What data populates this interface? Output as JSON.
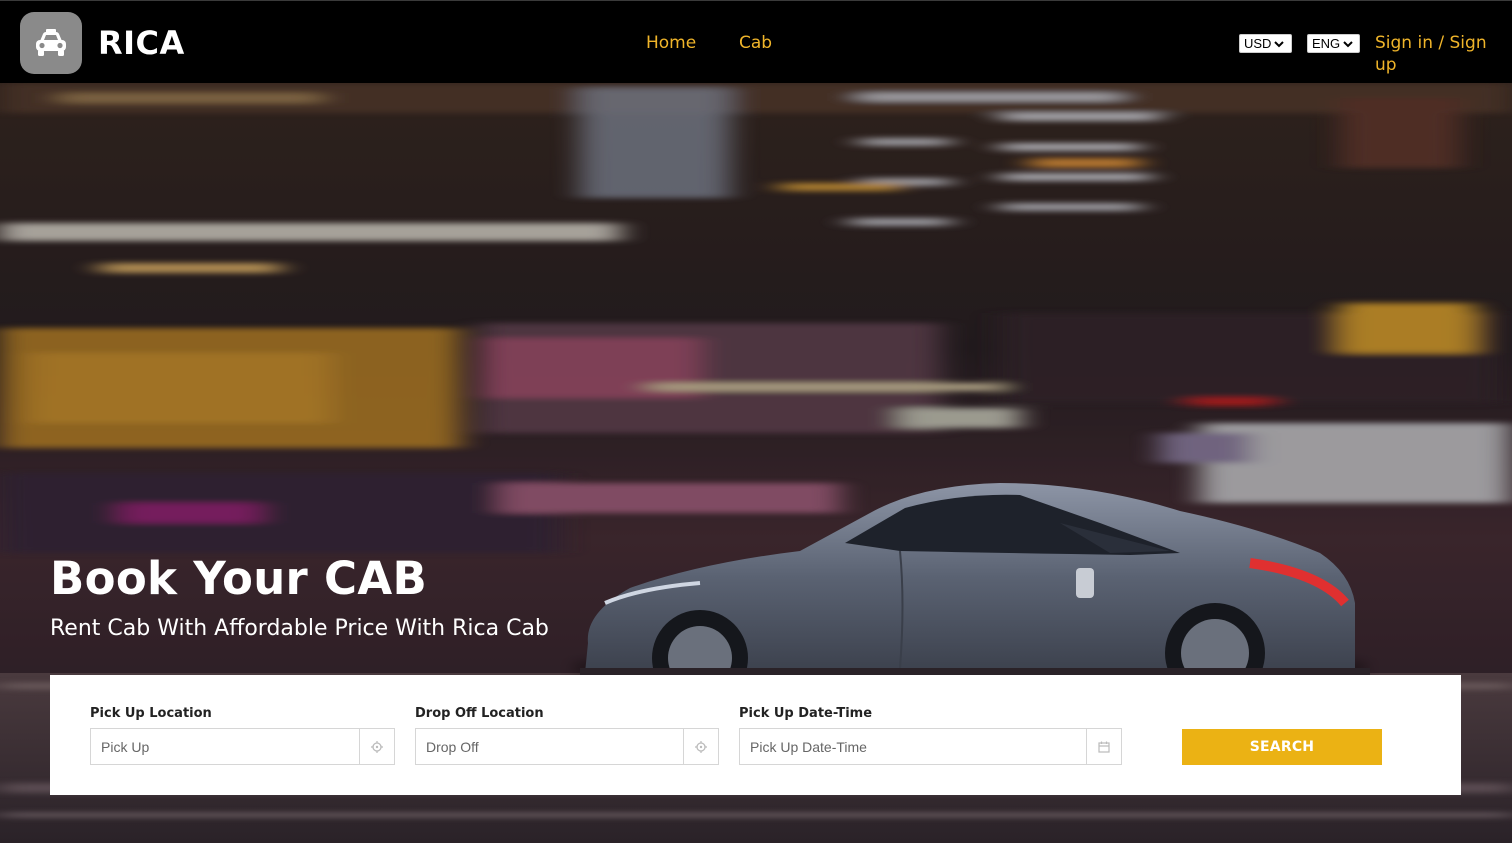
{
  "brand": {
    "name": "RICA",
    "logo_icon": "taxi-icon"
  },
  "nav": {
    "home": "Home",
    "cab": "Cab"
  },
  "header": {
    "currency": "USD",
    "language": "ENG",
    "auth_link": "Sign in / Sign up"
  },
  "hero": {
    "title": "Book Your CAB",
    "subtitle": "Rent Cab With Affordable Price With Rica Cab"
  },
  "search": {
    "pickup_label": "Pick Up Location",
    "pickup_placeholder": "Pick Up",
    "dropoff_label": "Drop Off Location",
    "dropoff_placeholder": "Drop Off",
    "datetime_label": "Pick Up Date-Time",
    "datetime_placeholder": "Pick Up Date-Time",
    "button": "SEARCH"
  },
  "colors": {
    "accent": "#ebb214",
    "nav_link": "#f0b52a",
    "header_bg": "#000000",
    "logo_badge": "#8a8a8a"
  }
}
